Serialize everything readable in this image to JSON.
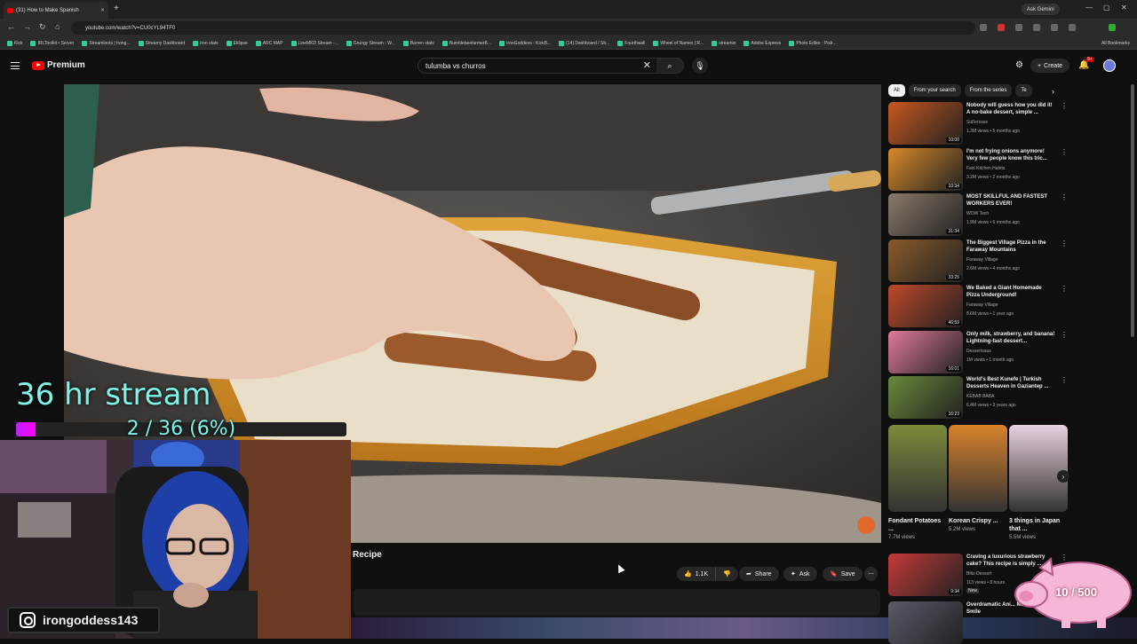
{
  "browser": {
    "tab_title": "(31) How to Make Spanish",
    "url": "youtube.com/watch?v=CU0cYL94TF0",
    "ask_gemini": "Ask Gemini",
    "all_bookmarks": "All Bookmarks",
    "bookmarks": [
      "Kick",
      "IRLToolkit • Server",
      "Streamloots | Irong...",
      "Streamy Dashboard",
      "Iron stats",
      "Eklipse",
      "ARC MAP",
      "LineMKD Stream -...",
      "Grungy Stream - W...",
      "Barren stats",
      "BumblebeefarmerB...",
      "IronGoddess - KickB...",
      "(14) Dashboard / Str...",
      "Fourthwall",
      "Wheel of Names | R...",
      "streamin",
      "Adobe Express",
      "Photo Editor : Pixlr..."
    ]
  },
  "youtube": {
    "brand": "Premium",
    "search_query": "tulumba vs churros",
    "create_label": "Create",
    "notification_count": "9+"
  },
  "stream_overlay": {
    "title": "36 hr stream",
    "progress_text": "2 / 36 (6%)",
    "progress_fraction": 0.06,
    "instagram_handle": "irongoddess143",
    "pig_counter": "10 / 500"
  },
  "video": {
    "title_fragment": "Recipe",
    "like_count": "1.1K",
    "share_label": "Share",
    "ask_label": "Ask",
    "save_label": "Save"
  },
  "sidebar": {
    "chips": [
      "All",
      "From your search",
      "From the series",
      "Te"
    ],
    "recommendations": [
      {
        "title": "Nobody will guess how you did it!  A no-bake dessert, simple ...",
        "channel": "Süßerosse",
        "meta": "1.3M views • 5 months ago",
        "duration": "10:00",
        "color": "#c8571e"
      },
      {
        "title": "I'm not frying onions anymore! Very few people know this tric...",
        "channel": "Fast Kitchen Habits",
        "meta": "3.2M views • 2 months ago",
        "duration": "10:34",
        "color": "#d98a2a"
      },
      {
        "title": "MOST SKILLFUL AND FASTEST WORKERS EVER!",
        "channel": "WOW Tech",
        "meta": "1.9M views • 6 months ago",
        "duration": "31:34",
        "color": "#8a7a6a"
      },
      {
        "title": "The Biggest Village Pizza in the Faraway Mountains",
        "channel": "Faraway Village",
        "meta": "2.6M views • 4 months ago",
        "duration": "33:25",
        "color": "#8a5a2a"
      },
      {
        "title": "We Baked a Giant Homemade Pizza Underground!",
        "channel": "Faraway Village",
        "meta": "8.6M views • 1 year ago",
        "duration": "46:59",
        "color": "#c0482a"
      },
      {
        "title": "Only milk, strawberry, and banana! Lightning-fast dessert...",
        "channel": "Dessertsaus",
        "meta": "1M views • 1 month ago",
        "duration": "16:01",
        "color": "#e07a9a"
      },
      {
        "title": "World's Best Kunefe | Turkish Desserts Heaven in Gaziantep ...",
        "channel": "KEBAB BABA",
        "meta": "6.4M views • 3 years ago",
        "duration": "16:23",
        "color": "#6a8a3a"
      }
    ],
    "shorts": [
      {
        "title": "Fondant Potatoes ...",
        "views": "7.7M views",
        "color": "#7a8a3a"
      },
      {
        "title": "Korean Crispy ...",
        "views": "5.2M views",
        "color": "#d9822a"
      },
      {
        "title": "3 things in Japan that ...",
        "views": "5.5M views",
        "color": "#e8d0e0"
      }
    ],
    "more_recommendations": [
      {
        "title": "Craving a luxurious strawberry cake? This recipe is simply ...",
        "channel": "Blitz-Dessert",
        "meta": "113 views • 8 hours",
        "badge": "New",
        "duration": "9:34",
        "color": "#c83a3a"
      },
      {
        "title": "Overdramatic Ani... Make You Smile",
        "channel": "",
        "meta": "",
        "badge": "",
        "duration": "",
        "color": "#5a5a6a"
      }
    ]
  }
}
